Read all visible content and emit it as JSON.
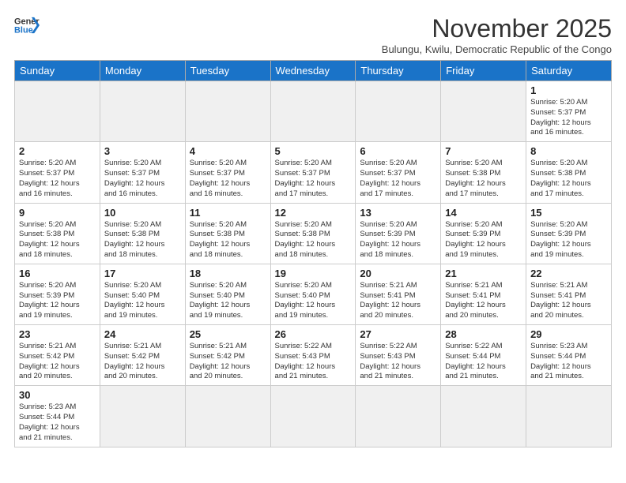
{
  "logo": {
    "line1": "General",
    "line2": "Blue"
  },
  "title": "November 2025",
  "subtitle": "Bulungu, Kwilu, Democratic Republic of the Congo",
  "headers": [
    "Sunday",
    "Monday",
    "Tuesday",
    "Wednesday",
    "Thursday",
    "Friday",
    "Saturday"
  ],
  "weeks": [
    [
      {
        "day": "",
        "info": ""
      },
      {
        "day": "",
        "info": ""
      },
      {
        "day": "",
        "info": ""
      },
      {
        "day": "",
        "info": ""
      },
      {
        "day": "",
        "info": ""
      },
      {
        "day": "",
        "info": ""
      },
      {
        "day": "1",
        "info": "Sunrise: 5:20 AM\nSunset: 5:37 PM\nDaylight: 12 hours\nand 16 minutes."
      }
    ],
    [
      {
        "day": "2",
        "info": "Sunrise: 5:20 AM\nSunset: 5:37 PM\nDaylight: 12 hours\nand 16 minutes."
      },
      {
        "day": "3",
        "info": "Sunrise: 5:20 AM\nSunset: 5:37 PM\nDaylight: 12 hours\nand 16 minutes."
      },
      {
        "day": "4",
        "info": "Sunrise: 5:20 AM\nSunset: 5:37 PM\nDaylight: 12 hours\nand 16 minutes."
      },
      {
        "day": "5",
        "info": "Sunrise: 5:20 AM\nSunset: 5:37 PM\nDaylight: 12 hours\nand 17 minutes."
      },
      {
        "day": "6",
        "info": "Sunrise: 5:20 AM\nSunset: 5:37 PM\nDaylight: 12 hours\nand 17 minutes."
      },
      {
        "day": "7",
        "info": "Sunrise: 5:20 AM\nSunset: 5:38 PM\nDaylight: 12 hours\nand 17 minutes."
      },
      {
        "day": "8",
        "info": "Sunrise: 5:20 AM\nSunset: 5:38 PM\nDaylight: 12 hours\nand 17 minutes."
      }
    ],
    [
      {
        "day": "9",
        "info": "Sunrise: 5:20 AM\nSunset: 5:38 PM\nDaylight: 12 hours\nand 18 minutes."
      },
      {
        "day": "10",
        "info": "Sunrise: 5:20 AM\nSunset: 5:38 PM\nDaylight: 12 hours\nand 18 minutes."
      },
      {
        "day": "11",
        "info": "Sunrise: 5:20 AM\nSunset: 5:38 PM\nDaylight: 12 hours\nand 18 minutes."
      },
      {
        "day": "12",
        "info": "Sunrise: 5:20 AM\nSunset: 5:38 PM\nDaylight: 12 hours\nand 18 minutes."
      },
      {
        "day": "13",
        "info": "Sunrise: 5:20 AM\nSunset: 5:39 PM\nDaylight: 12 hours\nand 18 minutes."
      },
      {
        "day": "14",
        "info": "Sunrise: 5:20 AM\nSunset: 5:39 PM\nDaylight: 12 hours\nand 19 minutes."
      },
      {
        "day": "15",
        "info": "Sunrise: 5:20 AM\nSunset: 5:39 PM\nDaylight: 12 hours\nand 19 minutes."
      }
    ],
    [
      {
        "day": "16",
        "info": "Sunrise: 5:20 AM\nSunset: 5:39 PM\nDaylight: 12 hours\nand 19 minutes."
      },
      {
        "day": "17",
        "info": "Sunrise: 5:20 AM\nSunset: 5:40 PM\nDaylight: 12 hours\nand 19 minutes."
      },
      {
        "day": "18",
        "info": "Sunrise: 5:20 AM\nSunset: 5:40 PM\nDaylight: 12 hours\nand 19 minutes."
      },
      {
        "day": "19",
        "info": "Sunrise: 5:20 AM\nSunset: 5:40 PM\nDaylight: 12 hours\nand 19 minutes."
      },
      {
        "day": "20",
        "info": "Sunrise: 5:21 AM\nSunset: 5:41 PM\nDaylight: 12 hours\nand 20 minutes."
      },
      {
        "day": "21",
        "info": "Sunrise: 5:21 AM\nSunset: 5:41 PM\nDaylight: 12 hours\nand 20 minutes."
      },
      {
        "day": "22",
        "info": "Sunrise: 5:21 AM\nSunset: 5:41 PM\nDaylight: 12 hours\nand 20 minutes."
      }
    ],
    [
      {
        "day": "23",
        "info": "Sunrise: 5:21 AM\nSunset: 5:42 PM\nDaylight: 12 hours\nand 20 minutes."
      },
      {
        "day": "24",
        "info": "Sunrise: 5:21 AM\nSunset: 5:42 PM\nDaylight: 12 hours\nand 20 minutes."
      },
      {
        "day": "25",
        "info": "Sunrise: 5:21 AM\nSunset: 5:42 PM\nDaylight: 12 hours\nand 20 minutes."
      },
      {
        "day": "26",
        "info": "Sunrise: 5:22 AM\nSunset: 5:43 PM\nDaylight: 12 hours\nand 21 minutes."
      },
      {
        "day": "27",
        "info": "Sunrise: 5:22 AM\nSunset: 5:43 PM\nDaylight: 12 hours\nand 21 minutes."
      },
      {
        "day": "28",
        "info": "Sunrise: 5:22 AM\nSunset: 5:44 PM\nDaylight: 12 hours\nand 21 minutes."
      },
      {
        "day": "29",
        "info": "Sunrise: 5:23 AM\nSunset: 5:44 PM\nDaylight: 12 hours\nand 21 minutes."
      }
    ],
    [
      {
        "day": "30",
        "info": "Sunrise: 5:23 AM\nSunset: 5:44 PM\nDaylight: 12 hours\nand 21 minutes."
      },
      {
        "day": "",
        "info": ""
      },
      {
        "day": "",
        "info": ""
      },
      {
        "day": "",
        "info": ""
      },
      {
        "day": "",
        "info": ""
      },
      {
        "day": "",
        "info": ""
      },
      {
        "day": "",
        "info": ""
      }
    ]
  ]
}
